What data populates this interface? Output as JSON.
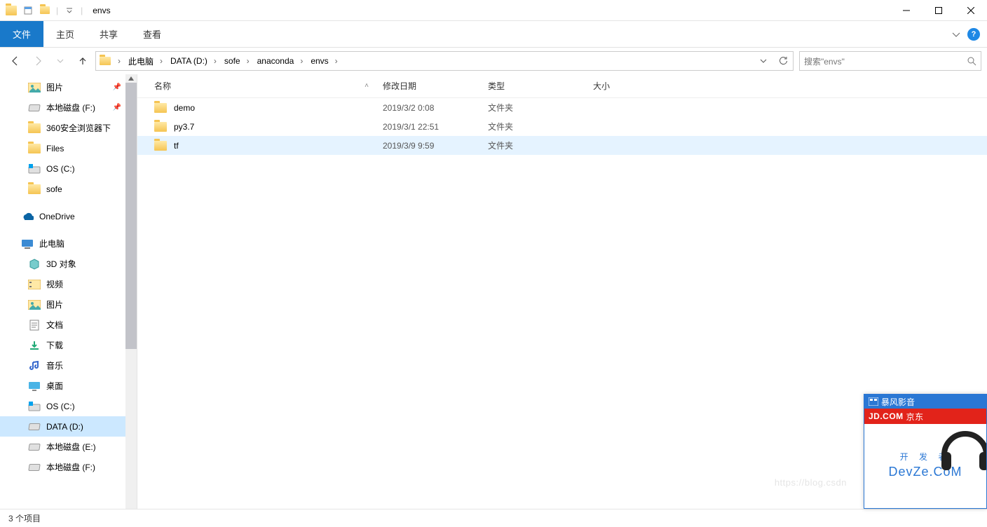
{
  "window": {
    "title": "envs"
  },
  "ribbon": {
    "file": "文件",
    "tabs": [
      "主页",
      "共享",
      "查看"
    ]
  },
  "breadcrumbs": [
    "此电脑",
    "DATA (D:)",
    "sofe",
    "anaconda",
    "envs"
  ],
  "search": {
    "placeholder": "搜索\"envs\""
  },
  "columns": {
    "name": "名称",
    "date": "修改日期",
    "type": "类型",
    "size": "大小"
  },
  "files": [
    {
      "name": "demo",
      "date": "2019/3/2 0:08",
      "type": "文件夹",
      "selected": false
    },
    {
      "name": "py3.7",
      "date": "2019/3/1 22:51",
      "type": "文件夹",
      "selected": false
    },
    {
      "name": "tf",
      "date": "2019/3/9 9:59",
      "type": "文件夹",
      "selected": true
    }
  ],
  "sidebar": [
    {
      "label": "图片",
      "level": 1,
      "icon": "pictures",
      "pin": true
    },
    {
      "label": "本地磁盘 (F:)",
      "level": 1,
      "icon": "disk",
      "pin": true
    },
    {
      "label": "360安全浏览器下",
      "level": 1,
      "icon": "folder"
    },
    {
      "label": "Files",
      "level": 1,
      "icon": "folder"
    },
    {
      "label": "OS (C:)",
      "level": 1,
      "icon": "disk-os"
    },
    {
      "label": "sofe",
      "level": 1,
      "icon": "folder"
    },
    {
      "label": "",
      "level": -1
    },
    {
      "label": "OneDrive",
      "level": 0,
      "icon": "onedrive"
    },
    {
      "label": "",
      "level": -1
    },
    {
      "label": "此电脑",
      "level": 0,
      "icon": "pc"
    },
    {
      "label": "3D 对象",
      "level": 1,
      "icon": "3d"
    },
    {
      "label": "视频",
      "level": 1,
      "icon": "video"
    },
    {
      "label": "图片",
      "level": 1,
      "icon": "pictures"
    },
    {
      "label": "文档",
      "level": 1,
      "icon": "docs"
    },
    {
      "label": "下载",
      "level": 1,
      "icon": "downloads"
    },
    {
      "label": "音乐",
      "level": 1,
      "icon": "music"
    },
    {
      "label": "桌面",
      "level": 1,
      "icon": "desktop"
    },
    {
      "label": "OS (C:)",
      "level": 1,
      "icon": "disk-os"
    },
    {
      "label": "DATA (D:)",
      "level": 1,
      "icon": "disk",
      "selected": true
    },
    {
      "label": "本地磁盘 (E:)",
      "level": 1,
      "icon": "disk"
    },
    {
      "label": "本地磁盘 (F:)",
      "level": 1,
      "icon": "disk"
    }
  ],
  "status": "3 个项目",
  "ad": {
    "header1": "暴风影音",
    "header2a": "JD.COM",
    "header2b": "京东",
    "line1": "开 发 者",
    "line2": "DevZe.CoM"
  },
  "watermark": "https://blog.csdn"
}
